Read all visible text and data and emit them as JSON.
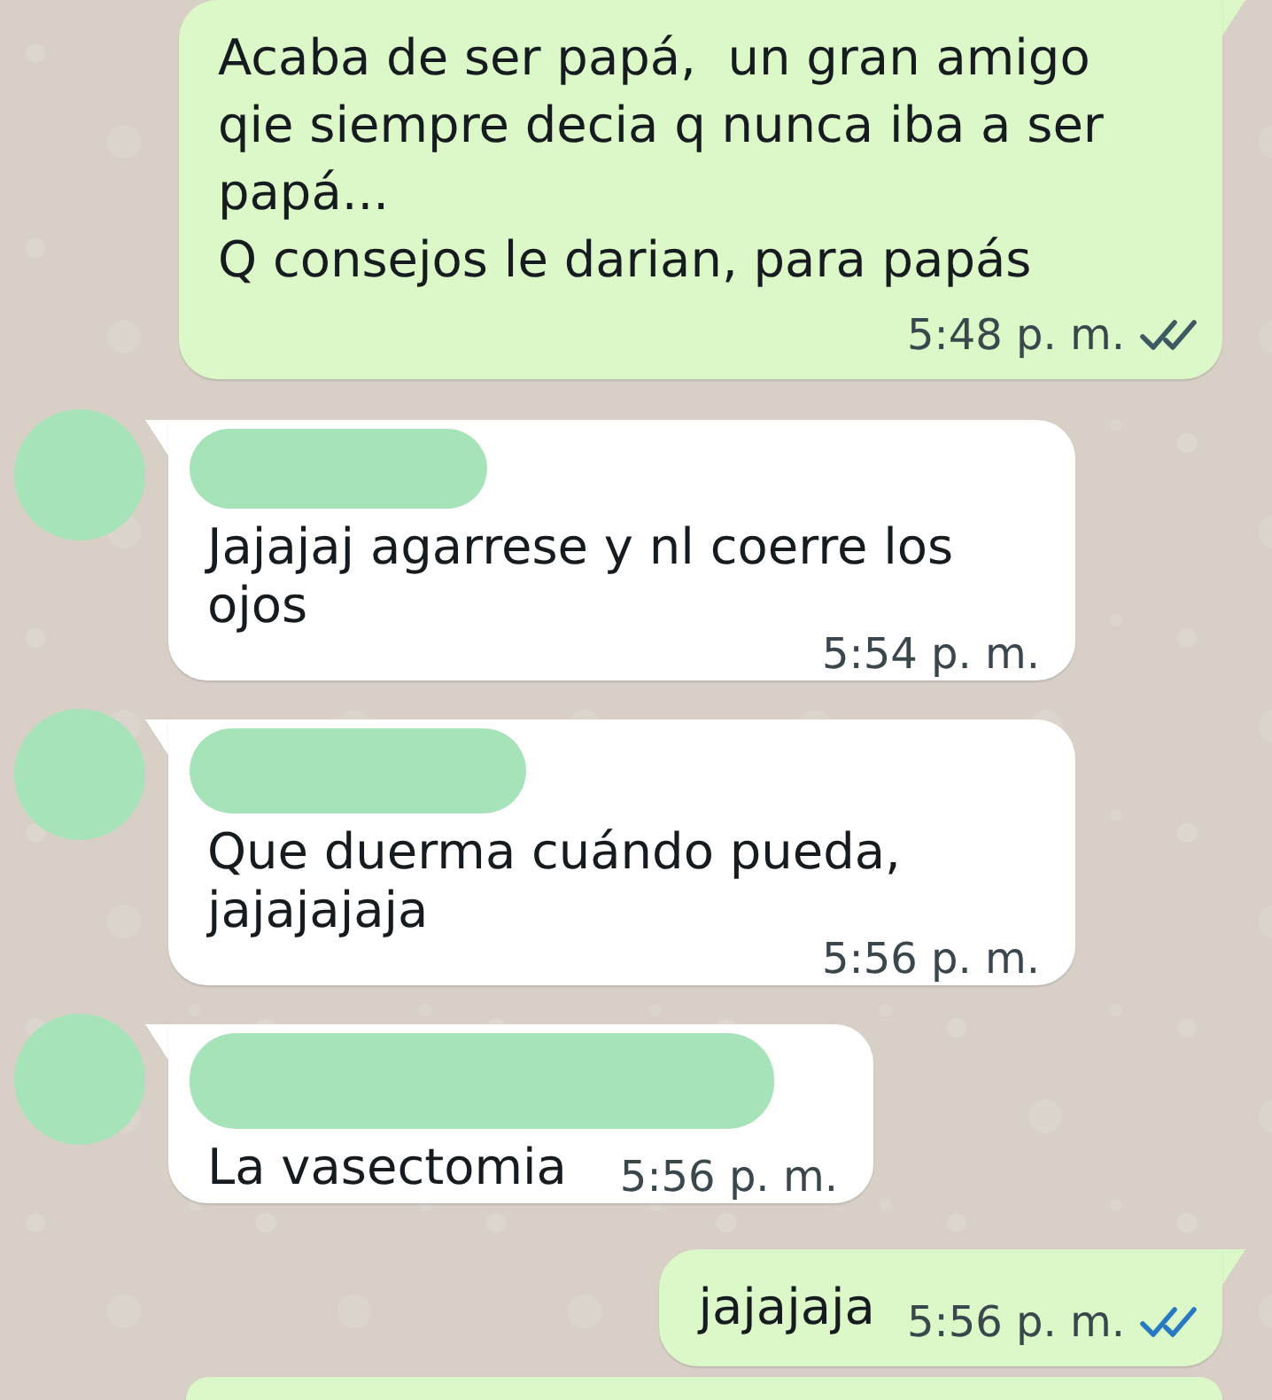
{
  "messages": [
    {
      "kind": "outgoing",
      "text": "Acaba de ser papá,  un gran amigo qie siempre decia q nunca iba a ser papá...\nQ consejos le darian, para papás",
      "time": "5:48 p. m.",
      "read": false
    },
    {
      "kind": "incoming",
      "text": "Jajajaj agarrese y nl coerre los ojos",
      "time": "5:54 p. m."
    },
    {
      "kind": "incoming",
      "text": "Que duerma cuándo pueda, jajajajaja",
      "time": "5:56 p. m."
    },
    {
      "kind": "incoming",
      "text": "La vasectomia",
      "time": "5:56 p. m."
    },
    {
      "kind": "outgoing",
      "text": "jajajaja",
      "time": "5:56 p. m.",
      "read": true
    },
    {
      "kind": "outgoing"
    }
  ]
}
